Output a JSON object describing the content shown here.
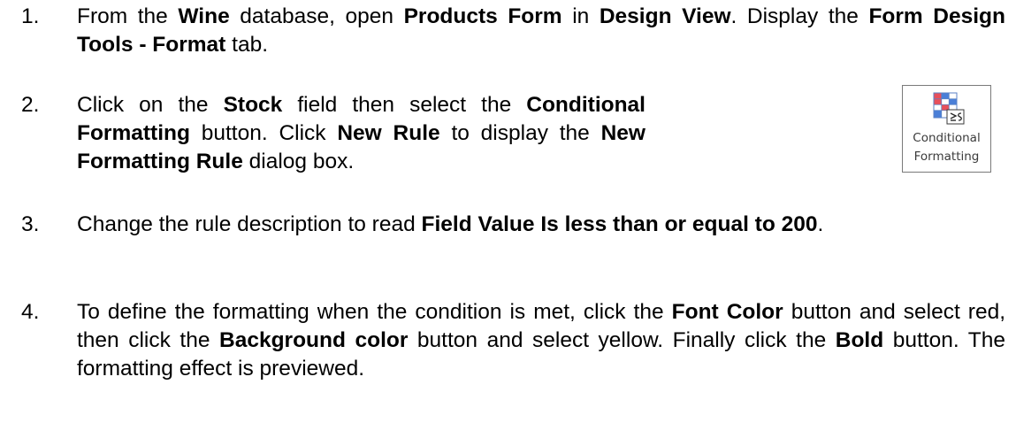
{
  "steps": [
    {
      "number": "1.",
      "segments": [
        {
          "text": "From the ",
          "bold": false
        },
        {
          "text": "Wine",
          "bold": true
        },
        {
          "text": " database, open ",
          "bold": false
        },
        {
          "text": "Products Form",
          "bold": true
        },
        {
          "text": " in ",
          "bold": false
        },
        {
          "text": "Design View",
          "bold": true
        },
        {
          "text": ". Display the ",
          "bold": false
        },
        {
          "text": "Form Design Tools - Format",
          "bold": true
        },
        {
          "text": " tab.",
          "bold": false
        }
      ]
    },
    {
      "number": "2.",
      "segments": [
        {
          "text": "Click on the ",
          "bold": false
        },
        {
          "text": "Stock",
          "bold": true
        },
        {
          "text": " field then select the ",
          "bold": false
        },
        {
          "text": "Conditional Formatting",
          "bold": true
        },
        {
          "text": " button. Click ",
          "bold": false
        },
        {
          "text": "New Rule",
          "bold": true
        },
        {
          "text": " to display the ",
          "bold": false
        },
        {
          "text": "New Formatting Rule",
          "bold": true
        },
        {
          "text": " dialog box.",
          "bold": false
        }
      ]
    },
    {
      "number": "3.",
      "segments": [
        {
          "text": "Change the rule description to read ",
          "bold": false
        },
        {
          "text": "Field Value Is less than or equal to 200",
          "bold": true
        },
        {
          "text": ".",
          "bold": false
        }
      ]
    },
    {
      "number": "4.",
      "segments": [
        {
          "text": "To define the formatting when the condition is met, click the ",
          "bold": false
        },
        {
          "text": "Font Color",
          "bold": true
        },
        {
          "text": " button and select red, then click the ",
          "bold": false
        },
        {
          "text": "Background color",
          "bold": true
        },
        {
          "text": " button and select yellow. Finally click the ",
          "bold": false
        },
        {
          "text": "Bold",
          "bold": true
        },
        {
          "text": " button. The formatting effect is previewed.",
          "bold": false
        }
      ]
    }
  ],
  "conditional_formatting_button": {
    "label_line_1": "Conditional",
    "label_line_2": "Formatting",
    "icon": "conditional-formatting-icon"
  }
}
